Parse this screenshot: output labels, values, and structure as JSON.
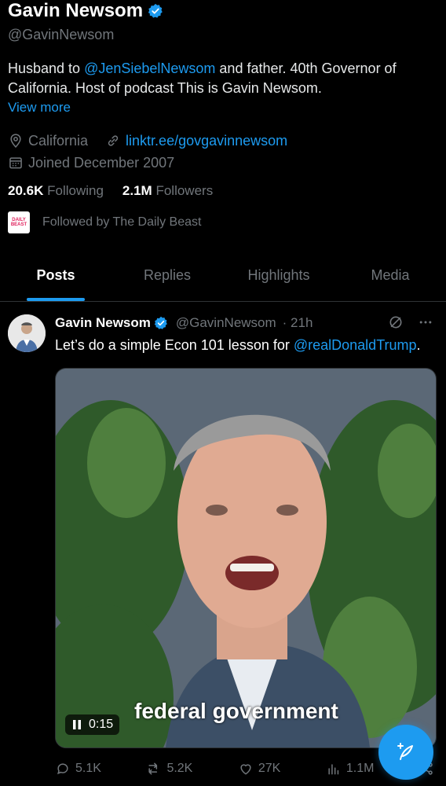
{
  "profile": {
    "name": "Gavin Newsom",
    "handle": "@GavinNewsom",
    "bio_pre": "Husband to ",
    "bio_mention": "@JenSiebelNewsom",
    "bio_post": " and father. 40th Governor of California. Host of podcast This is Gavin Newsom.",
    "view_more": "View more",
    "location": "California",
    "link": "linktr.ee/govgavinnewsom",
    "joined": "Joined December 2007",
    "following_count": "20.6K",
    "following_label": "Following",
    "followers_count": "2.1M",
    "followers_label": "Followers",
    "followed_by": "Followed by The Daily Beast",
    "followed_avatar_text": "DAILY BEAST"
  },
  "tabs": [
    "Posts",
    "Replies",
    "Highlights",
    "Media"
  ],
  "post": {
    "name": "Gavin Newsom",
    "handle": "@GavinNewsom",
    "time": "· 21h",
    "text_pre": "Let’s do a simple Econ 101 lesson for ",
    "text_mention": "@realDonaldTrump",
    "text_post": ".",
    "video_caption": "federal government",
    "video_time": "0:15",
    "replies": "5.1K",
    "reposts": "5.2K",
    "likes": "27K",
    "views": "1.1M"
  },
  "colors": {
    "accent": "#1d9bf0",
    "muted": "#71767b",
    "background": "#000000"
  },
  "icons": [
    "verified-badge-icon",
    "location-icon",
    "link-icon",
    "calendar-icon",
    "grok-icon",
    "more-icon",
    "pause-icon",
    "reply-icon",
    "repost-icon",
    "like-icon",
    "views-icon",
    "compose-icon",
    "share-icon"
  ]
}
